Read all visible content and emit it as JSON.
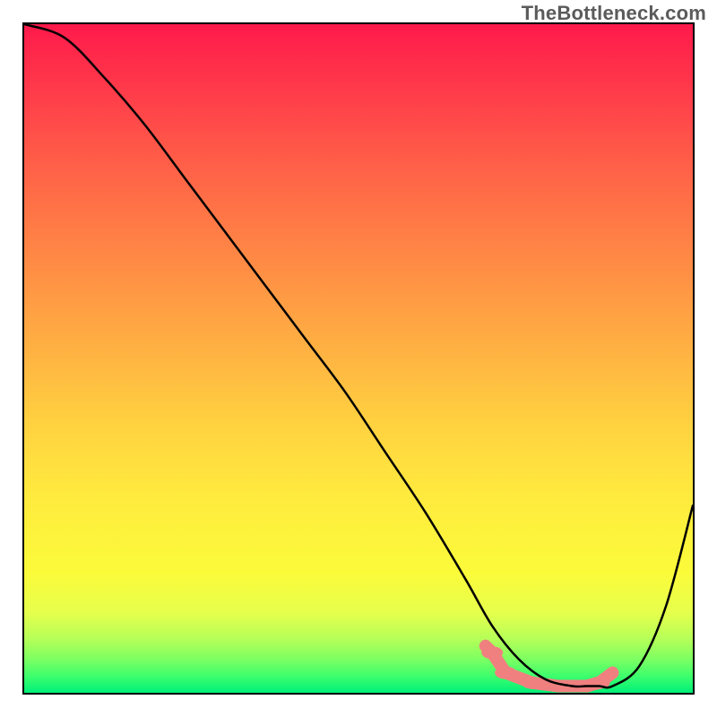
{
  "watermark": "TheBottleneck.com",
  "chart_data": {
    "type": "line",
    "title": "",
    "xlabel": "",
    "ylabel": "",
    "xlim": [
      0,
      100
    ],
    "ylim": [
      0,
      100
    ],
    "grid": false,
    "legend": false,
    "background_gradient": {
      "top": "#ff1a4b",
      "middle": "#ffe93e",
      "bottom": "#00ef78"
    },
    "series": [
      {
        "name": "bottleneck-curve",
        "color": "#000000",
        "x": [
          0,
          6,
          12,
          18,
          24,
          30,
          36,
          42,
          48,
          54,
          60,
          66,
          70,
          74,
          78,
          82,
          84,
          86,
          88,
          92,
          96,
          100
        ],
        "values": [
          100,
          98,
          92,
          85,
          77,
          69,
          61,
          53,
          45,
          36,
          27,
          17,
          10,
          5,
          2,
          1,
          1,
          1,
          1,
          4,
          13,
          28
        ]
      }
    ],
    "markers": [
      {
        "name": "highlight-band",
        "color": "#f08080",
        "shape": "rounded-pill",
        "x": [
          69,
          70,
          72,
          76,
          80,
          84,
          86,
          88
        ],
        "values": [
          7,
          6,
          3,
          1.5,
          1,
          1,
          1.5,
          3
        ]
      }
    ]
  }
}
